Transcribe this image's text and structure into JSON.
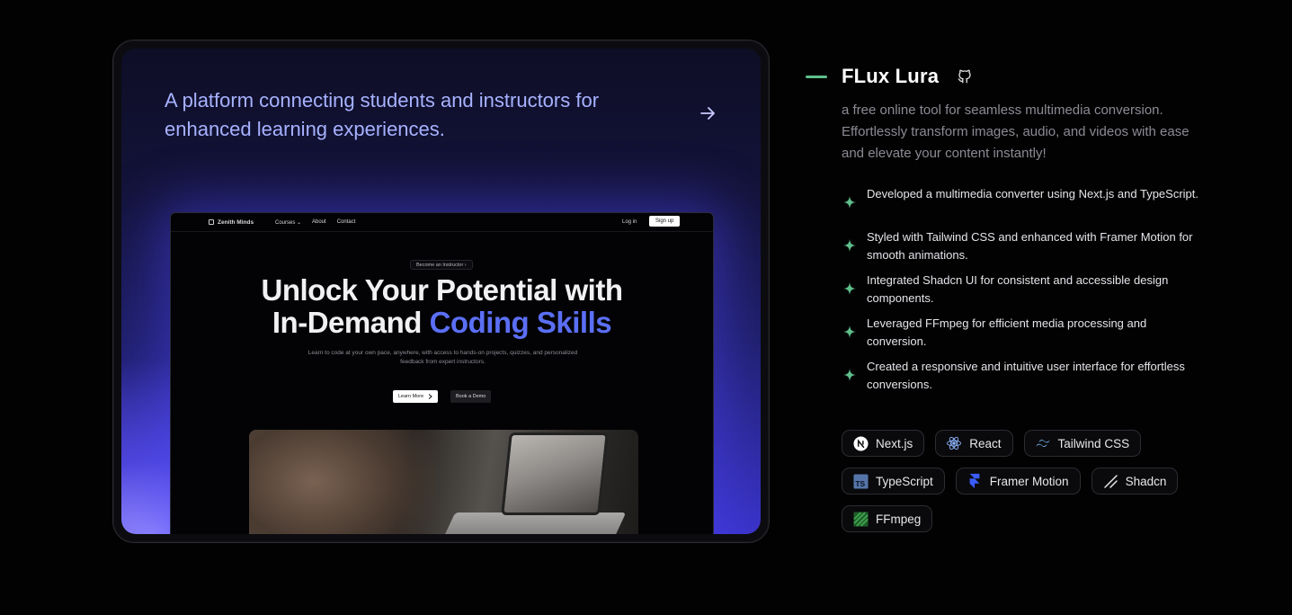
{
  "preview": {
    "tagline": "A platform connecting students and instructors for enhanced learning experiences.",
    "site": {
      "brand": "Zenith Minds",
      "nav_links": [
        "Courses ⌄",
        "About",
        "Contact"
      ],
      "login": "Log in",
      "signup": "Sign up",
      "pill": "Become an Instructor  ›",
      "headline_1": "Unlock Your Potential with",
      "headline_2": "In-Demand ",
      "headline_accent": "Coding Skills",
      "subtitle": "Learn to code at your own pace, anywhere, with access to hands-on projects, quizzes, and personalized feedback from expert instructors.",
      "primary_button": "Learn More",
      "secondary_button": "Book a Demo"
    }
  },
  "project": {
    "title": "FLux Lura",
    "description": "a free online tool for seamless multimedia conversion. Effortlessly transform images, audio, and videos with ease and elevate your content instantly!",
    "bullets": [
      "Developed a multimedia converter using Next.js and TypeScript.",
      "Styled with Tailwind CSS and enhanced with Framer Motion for smooth animations.",
      "Integrated Shadcn UI for consistent and accessible design components.",
      "Leveraged FFmpeg for efficient media processing and conversion.",
      "Created a responsive and intuitive user interface for effortless conversions."
    ],
    "tags": [
      {
        "label": "Next.js",
        "icon": "nextjs-icon"
      },
      {
        "label": "React",
        "icon": "react-icon"
      },
      {
        "label": "Tailwind CSS",
        "icon": "tailwind-icon"
      },
      {
        "label": "TypeScript",
        "icon": "typescript-icon"
      },
      {
        "label": "Framer Motion",
        "icon": "framer-icon"
      },
      {
        "label": "Shadcn",
        "icon": "shadcn-icon"
      },
      {
        "label": "FFmpeg",
        "icon": "ffmpeg-icon"
      }
    ]
  },
  "colors": {
    "accent_green": "#5fbf8b",
    "tagline_blue": "#a7b2ff",
    "coding_skills_blue": "#5b6ff5"
  }
}
